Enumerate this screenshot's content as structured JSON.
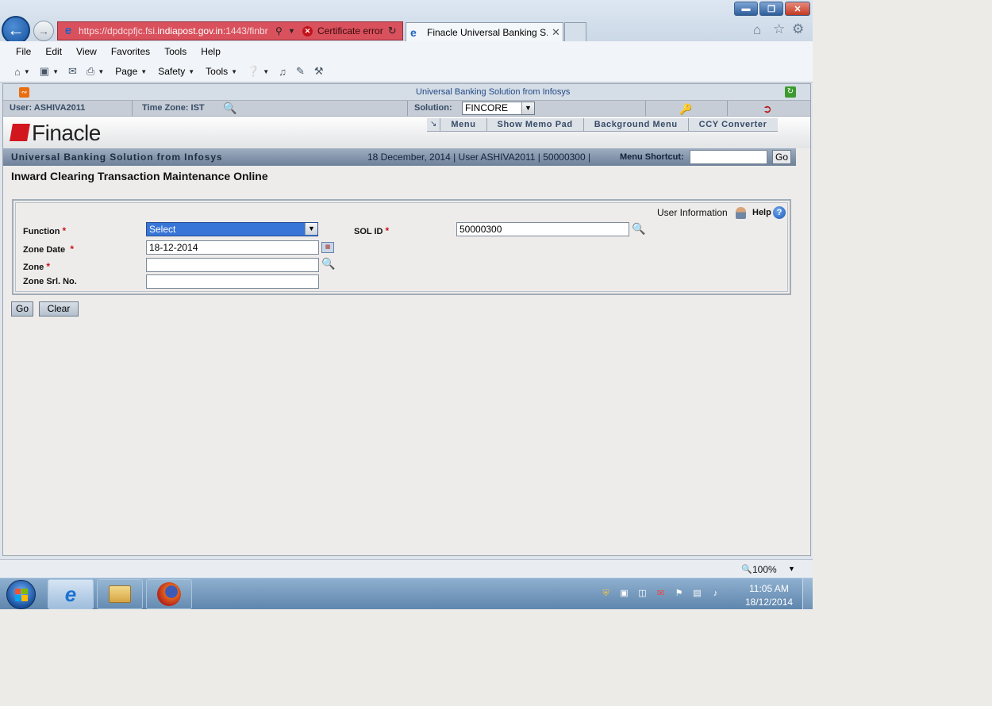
{
  "browser": {
    "address": {
      "url_prefix": "https://dpdcpfjc.fsi.",
      "url_domain": "indiapost.gov.in",
      "url_suffix": ":1443/finbr",
      "cert_error": "Certificate error"
    },
    "tab_title": "Finacle Universal Banking S...",
    "menu": [
      "File",
      "Edit",
      "View",
      "Favorites",
      "Tools",
      "Help"
    ],
    "commands": {
      "page": "Page",
      "safety": "Safety",
      "tools": "Tools"
    },
    "zoom": "100%"
  },
  "finacle": {
    "banner": "Universal Banking Solution from Infosys",
    "user_label": "User: ASHIVA2011",
    "timezone_label": "Time Zone:  IST",
    "solution_label": "Solution:",
    "solution_value": "FINCORE",
    "logo_text": "Finacle",
    "nav": [
      "Menu",
      "Show Memo Pad",
      "Background Menu",
      "CCY Converter"
    ],
    "title": "Universal Banking Solution from Infosys",
    "status": "18 December, 2014  |  User  ASHIVA2011  |  50000300  |",
    "shortcut_label": "Menu Shortcut:",
    "shortcut_go": "Go"
  },
  "page": {
    "title": "Inward Clearing Transaction Maintenance  Online",
    "user_info": "User Information",
    "help": "Help",
    "fields": {
      "function_label": "Function",
      "function_value": "Select",
      "zone_date_label": "Zone Date",
      "zone_date_value": "18-12-2014",
      "zone_label": "Zone",
      "zone_value": "",
      "zone_srl_label": "Zone Srl. No.",
      "zone_srl_value": "",
      "sol_id_label": "SOL ID",
      "sol_id_value": "50000300",
      "required_mark": "*"
    },
    "buttons": {
      "go": "Go",
      "clear": "Clear"
    }
  },
  "taskbar": {
    "time": "11:05 AM",
    "date": "18/12/2014"
  },
  "colors": {
    "finacle_red": "#d2161d",
    "select_highlight": "#3875d7",
    "cert_error_bg": "#d9515d"
  }
}
